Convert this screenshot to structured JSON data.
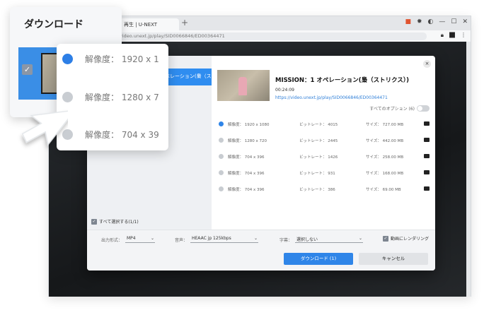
{
  "browser": {
    "tab_title": "再生 | U-NEXT",
    "tab_plus": "+",
    "url": "video.unext.jp/play/SID0066846/ED00364471"
  },
  "dialog": {
    "close_glyph": "×",
    "left_item_label": "ペレーション(梟（ス...",
    "select_all_label": "すべて選択する(1/1)",
    "select_all_check": "✓",
    "title": "MISSION：1 オペレーション(梟（ストリクス）)",
    "duration": "00:24:09",
    "url": "https://video.unext.jp/play/SID0066846/ED00364471",
    "all_options_label": "すべてのオプション (6)",
    "options": [
      {
        "resolution": "解像度： 1920 x 1080",
        "bitrate": "ビットレート： 4015",
        "size": "サイズ： 727.00 MB",
        "selected": true
      },
      {
        "resolution": "解像度： 1280 x 720",
        "bitrate": "ビットレート： 2445",
        "size": "サイズ： 442.00 MB",
        "selected": false
      },
      {
        "resolution": "解像度： 704 x 396",
        "bitrate": "ビットレート： 1426",
        "size": "サイズ： 258.00 MB",
        "selected": false
      },
      {
        "resolution": "解像度： 704 x 396",
        "bitrate": "ビットレート： 931",
        "size": "サイズ： 168.00 MB",
        "selected": false
      },
      {
        "resolution": "解像度： 704 x 396",
        "bitrate": "ビットレート： 386",
        "size": "サイズ： 69.00 MB",
        "selected": false
      }
    ],
    "format_label": "出力形式：",
    "format_value": "MP4",
    "audio_label": "音声：",
    "audio_value": "HEAAC jp 125kbps",
    "subtitle_label": "字幕：",
    "subtitle_value": "選択しない",
    "render_label": "動画にレンダリング",
    "render_check": "✓",
    "download_button": "ダウンロード (1)",
    "cancel_button": "キャンセル",
    "caret": "⌄"
  },
  "zoom_download": {
    "title": "ダウンロード",
    "check": "✓"
  },
  "zoom_resolution": {
    "rows": [
      {
        "text": "解像度： 1920 x 1",
        "selected": true
      },
      {
        "text": "解像度： 1280 x 7",
        "selected": false
      },
      {
        "text": "解像度： 704 x 39",
        "selected": false
      }
    ]
  },
  "colors": {
    "accent": "#2f85e8",
    "dark_bg": "#1e2124"
  },
  "icons": {
    "window_controls": [
      "gift-icon",
      "gear-icon",
      "moon-icon",
      "minimize-icon",
      "maximize-icon",
      "close-icon"
    ],
    "address_icons": [
      "lock-icon",
      "extension-icon",
      "menu-dots-icon"
    ]
  }
}
